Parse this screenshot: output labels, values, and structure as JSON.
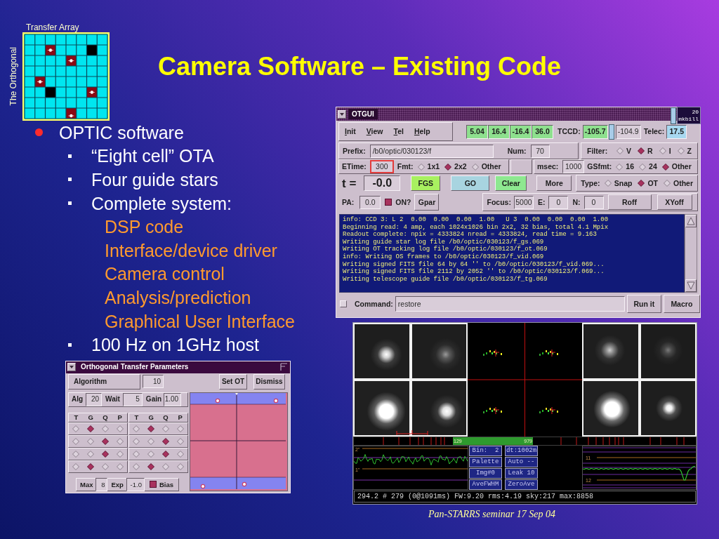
{
  "title": "Camera Software – Existing Code",
  "transfer_array": {
    "caption": "Transfer Array",
    "side_label": "The Orthogonal"
  },
  "bullets": [
    {
      "text": "OPTIC software",
      "children": [
        {
          "text": "“Eight cell” OTA"
        },
        {
          "text": "Four guide stars"
        },
        {
          "text": "Complete system:",
          "children": [
            {
              "text": "DSP code"
            },
            {
              "text": "Interface/device driver"
            },
            {
              "text": "Camera control"
            },
            {
              "text": "Analysis/prediction"
            },
            {
              "text": "Graphical User Interface"
            }
          ]
        },
        {
          "text": "100 Hz on 1GHz host"
        }
      ]
    }
  ],
  "ot_window": {
    "title": "Orthogonal Transfer Parameters",
    "algorithm": {
      "label": "Algorithm",
      "value": "10"
    },
    "buttons": [
      "Set OT",
      "Dismiss"
    ],
    "fields": [
      {
        "label": "Alg",
        "value": "20"
      },
      {
        "label": "Wait",
        "value": "5"
      },
      {
        "label": "Gain",
        "value": "1.00"
      }
    ],
    "groups": [
      {
        "columns": [
          "T",
          "G",
          "Q",
          "P"
        ],
        "rows": [
          {
            "choices": [
              {
                "selected": false
              },
              {
                "selected": true
              },
              {
                "selected": false
              },
              {
                "selected": false
              }
            ]
          },
          {
            "choices": [
              {
                "selected": false
              },
              {
                "selected": false
              },
              {
                "selected": true
              },
              {
                "selected": false
              }
            ]
          },
          {
            "choices": [
              {
                "selected": false
              },
              {
                "selected": false
              },
              {
                "selected": true
              },
              {
                "selected": false
              }
            ]
          },
          {
            "choices": [
              {
                "selected": false
              },
              {
                "selected": true
              },
              {
                "selected": false
              },
              {
                "selected": false
              }
            ]
          }
        ]
      },
      {
        "columns": [
          "T",
          "G",
          "Q",
          "P"
        ],
        "rows": [
          {
            "choices": [
              {
                "selected": false
              },
              {
                "selected": true
              },
              {
                "selected": false
              },
              {
                "selected": false
              }
            ]
          },
          {
            "choices": [
              {
                "selected": false
              },
              {
                "selected": false
              },
              {
                "selected": true
              },
              {
                "selected": false
              }
            ]
          },
          {
            "choices": [
              {
                "selected": false
              },
              {
                "selected": false
              },
              {
                "selected": true
              },
              {
                "selected": false
              }
            ]
          },
          {
            "choices": [
              {
                "selected": false
              },
              {
                "selected": true
              },
              {
                "selected": false
              },
              {
                "selected": false
              }
            ]
          }
        ]
      }
    ],
    "limits": [
      {
        "label": "Max",
        "value": "8"
      },
      {
        "label": "Exp",
        "value": "-1.0"
      }
    ],
    "bias": {
      "label": "Bias",
      "checked": true
    }
  },
  "otgui": {
    "title": "OTGUI",
    "icon_box": {
      "number": "20",
      "label": "mkbill"
    },
    "menu": [
      "Init",
      "View",
      "Tel",
      "Help"
    ],
    "readouts": [
      "5.04",
      "16.4",
      "-16.4",
      "36.0"
    ],
    "tccd": {
      "label": "TCCD:",
      "value": "-105.7",
      "setpoint": "-104.9"
    },
    "telec": {
      "label": "Telec:",
      "value": "17.5"
    },
    "prefix": {
      "label": "Prefix:",
      "value": "/b0/optic/030123/f"
    },
    "num": {
      "label": "Num:",
      "value": "70"
    },
    "filter": {
      "label": "Filter:",
      "options": [
        {
          "label": "V",
          "selected": false
        },
        {
          "label": "R",
          "selected": true
        },
        {
          "label": "I",
          "selected": false
        },
        {
          "label": "Z",
          "selected": false
        }
      ]
    },
    "etime": {
      "label": "ETime:",
      "value": "300",
      "focused": true
    },
    "fmt": {
      "label": "Fmt:",
      "options": [
        {
          "label": "1x1",
          "selected": false
        },
        {
          "label": "2x2",
          "selected": true
        },
        {
          "label": "Other",
          "selected": false
        }
      ]
    },
    "msec": {
      "label": "msec:",
      "value": "1000"
    },
    "gsfmt": {
      "label": "GSfmt:",
      "options": [
        {
          "label": "16",
          "selected": false
        },
        {
          "label": "24",
          "selected": false
        },
        {
          "label": "Other",
          "selected": true
        }
      ]
    },
    "timer": {
      "label": "t =",
      "value": "-0.0"
    },
    "actions": [
      {
        "label": "FGS",
        "color": "#a8f060"
      },
      {
        "label": "GO",
        "color": "#a8d4e0"
      },
      {
        "label": "Clear",
        "color": "#8ee890"
      },
      {
        "label": "More",
        "color": "#cdbfcd"
      }
    ],
    "type": {
      "label": "Type:",
      "options": [
        {
          "label": "Snap",
          "selected": false
        },
        {
          "label": "OT",
          "selected": true
        },
        {
          "label": "Other",
          "selected": false
        }
      ]
    },
    "pa": {
      "label": "PA:",
      "value": "0.0"
    },
    "on": {
      "label": "ON?",
      "checked": true
    },
    "gpar": "Gpar",
    "focus": {
      "label": "Focus:",
      "value": "5000"
    },
    "offsets": [
      {
        "label": "E:",
        "value": "0"
      },
      {
        "label": "N:",
        "value": "0"
      }
    ],
    "offset_buttons": [
      "Roff",
      "XYoff"
    ],
    "log": [
      "info: CCD 3: L 2  0.00  0.00  0.00  1.00   U 3  0.00  0.00  0.00  1.00",
      "Beginning read: 4 amp, each 1024x1026 bin 2x2, 32 bias, total 4.1 Mpix",
      "Readout complete: npix = 4333824 nread = 4333824, read time = 9.163",
      "Writing guide star log file /b0/optic/030123/f_gs.069",
      "Writing OT tracking log file /b0/optic/030123/f_ot.069",
      "info: Writing OS frames to /b0/optic/030123/f_vid.069",
      "Writing signed FITS file 64 by 64 '' to /b0/optic/030123/f_vid.069...",
      "Writing signed FITS file 2112 by 2052 '' to /b0/optic/030123/f.069...",
      "Writing telescope guide file /b0/optic/030123/f_tg.069"
    ],
    "command": {
      "checked": false,
      "label": "Command:",
      "value": "restore"
    },
    "command_buttons": [
      "Run it",
      "Macro"
    ]
  },
  "display": {
    "timeline": [
      "129",
      "979"
    ],
    "left_graph": [
      "2\"",
      "1\""
    ],
    "controls": [
      "Bin:  2",
      "dt:1002m",
      "Palette",
      "Auto --",
      "Img#0",
      "Leak 10",
      "AveFWHM",
      "ZeroAve"
    ],
    "right_graph": [
      "11",
      "12"
    ],
    "status": "294.2 # 279 (0@1091ms) FW:9.20 rms:4.19 sky:217 max:8858"
  },
  "footer": "Pan-STARRS seminar 17 Sep 04"
}
